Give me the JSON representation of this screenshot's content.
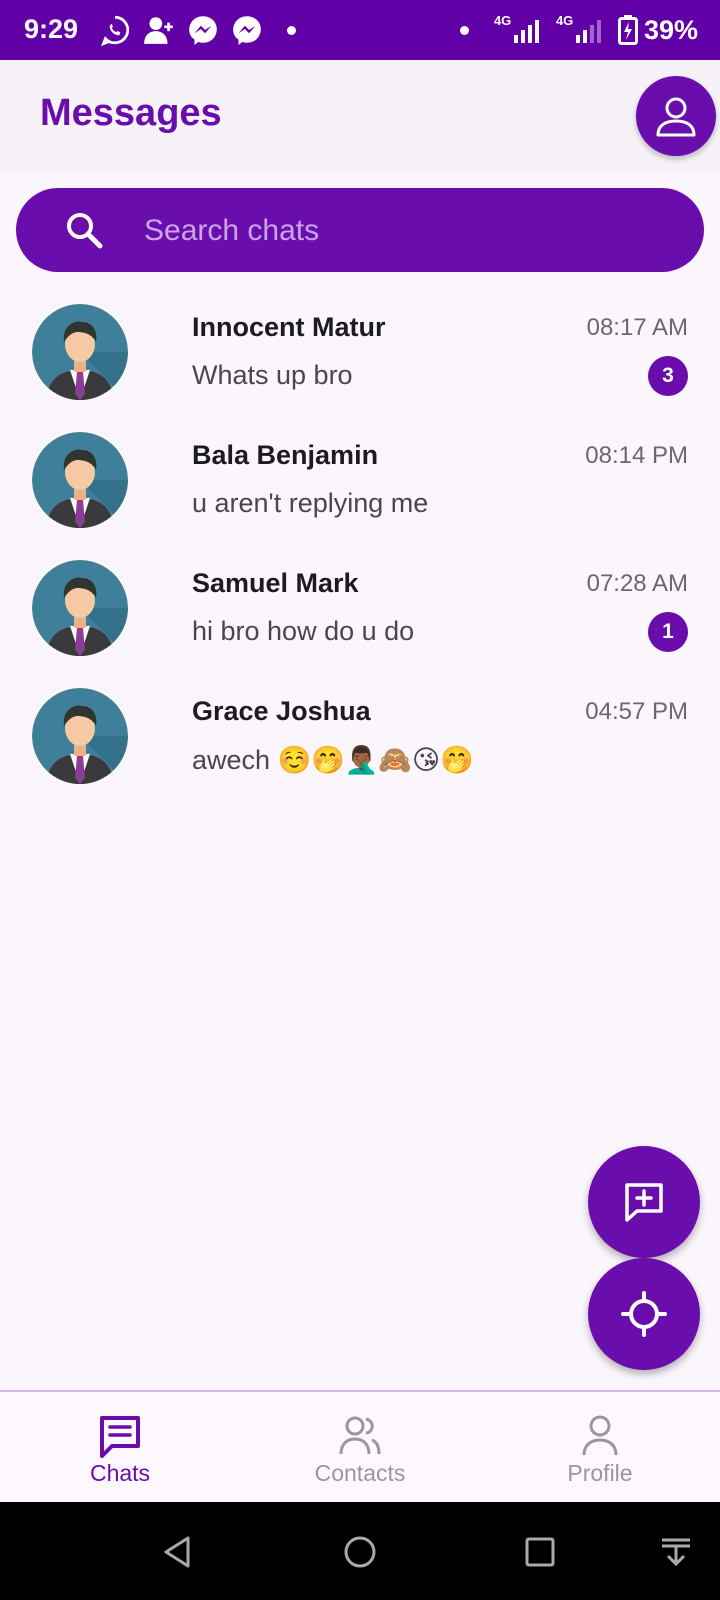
{
  "status_bar": {
    "time": "9:29",
    "network_1": "4G",
    "network_2": "4G",
    "battery": "39%"
  },
  "header": {
    "title": "Messages"
  },
  "search": {
    "placeholder": "Search chats"
  },
  "chats": [
    {
      "name": "Innocent Matur",
      "time": "08:17 AM",
      "message": "Whats up bro",
      "unread": "3"
    },
    {
      "name": "Bala Benjamin",
      "time": "08:14 PM",
      "message": "u aren't replying me",
      "unread": ""
    },
    {
      "name": "Samuel Mark",
      "time": "07:28 AM",
      "message": "hi bro how do u do",
      "unread": "1"
    },
    {
      "name": "Grace Joshua",
      "time": "04:57 PM",
      "message": "awech ☺️🤭🤦🏾‍♂️🙈😘🤭",
      "unread": ""
    }
  ],
  "bottom_nav": [
    {
      "label": "Chats",
      "active": true
    },
    {
      "label": "Contacts",
      "active": false
    },
    {
      "label": "Profile",
      "active": false
    }
  ],
  "icons": {
    "profile": "person-icon",
    "search": "search-icon",
    "new_chat": "message-plus-icon",
    "locate": "crosshair-icon"
  },
  "colors": {
    "primary": "#6a0dad",
    "status_bar": "#6200a8",
    "background": "#fbf6fc"
  }
}
